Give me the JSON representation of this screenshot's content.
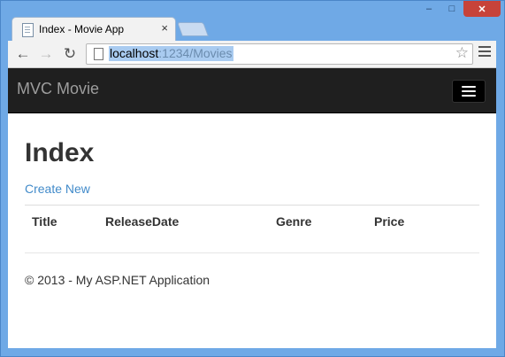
{
  "browser": {
    "tab_title": "Index - Movie App",
    "tab_close": "×",
    "url_host": "localhost",
    "url_rest": ":1234/Movies",
    "window_controls": {
      "minimize": "‒",
      "maximize": "□",
      "close": "✕"
    },
    "nav": {
      "back": "←",
      "forward": "→",
      "reload": "↻"
    },
    "bookmark_star": "☆"
  },
  "app": {
    "brand": "MVC Movie",
    "page_title": "Index",
    "create_link": "Create New",
    "table_headers": [
      "Title",
      "ReleaseDate",
      "Genre",
      "Price"
    ],
    "footer": "© 2013 - My ASP.NET Application"
  }
}
